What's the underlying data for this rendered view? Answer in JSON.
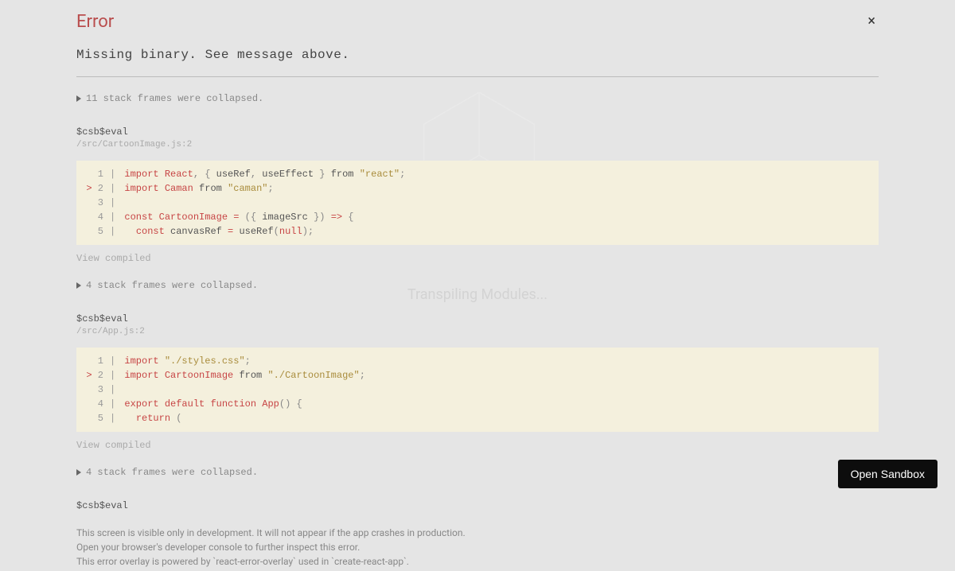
{
  "header": {
    "title": "Error",
    "close_label": "×"
  },
  "message": "Missing binary. See message above.",
  "collapse1": "11 stack frames were collapsed.",
  "frame1": {
    "name": "$csb$eval",
    "path": "/src/CartoonImage.js:2"
  },
  "code1": {
    "l1_num": "1",
    "l2_mark": ">",
    "l2_num": "2",
    "l3_num": "3",
    "l4_num": "4",
    "l5_num": "5"
  },
  "view_compiled": "View compiled",
  "collapse2": "4 stack frames were collapsed.",
  "frame2": {
    "name": "$csb$eval",
    "path": "/src/App.js:2"
  },
  "code2": {
    "l1_num": "1",
    "l2_mark": ">",
    "l2_num": "2",
    "l3_num": "3",
    "l4_num": "4",
    "l5_num": "5"
  },
  "collapse3": "4 stack frames were collapsed.",
  "frame3": {
    "name": "$csb$eval"
  },
  "notes": {
    "l1": "This screen is visible only in development. It will not appear if the app crashes in production.",
    "l2": "Open your browser's developer console to further inspect this error.",
    "l3": "This error overlay is powered by `react-error-overlay` used in `create-react-app`."
  },
  "sandbox_btn": "Open Sandbox",
  "bg_text": "Transpiling Modules..."
}
